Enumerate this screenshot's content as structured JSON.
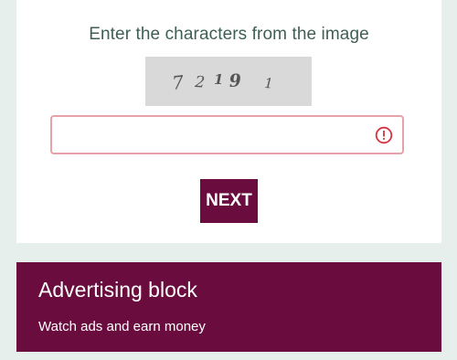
{
  "captcha_form": {
    "heading": "Enter the characters from the image",
    "captcha_text": "7 2 1 9 1",
    "input_value": "",
    "input_placeholder": "",
    "error_state": true,
    "next_label": "NEXT"
  },
  "ad_block": {
    "title": "Advertising block",
    "subtitle": "Watch ads and earn money"
  },
  "colors": {
    "background": "#e6efec",
    "card": "#ffffff",
    "heading_text": "#3f5f55",
    "brand": "#6a0d3e",
    "error": "#d9323f",
    "captcha_bg": "#d9d9d9"
  },
  "icons": {
    "error": "alert-circle-icon"
  }
}
